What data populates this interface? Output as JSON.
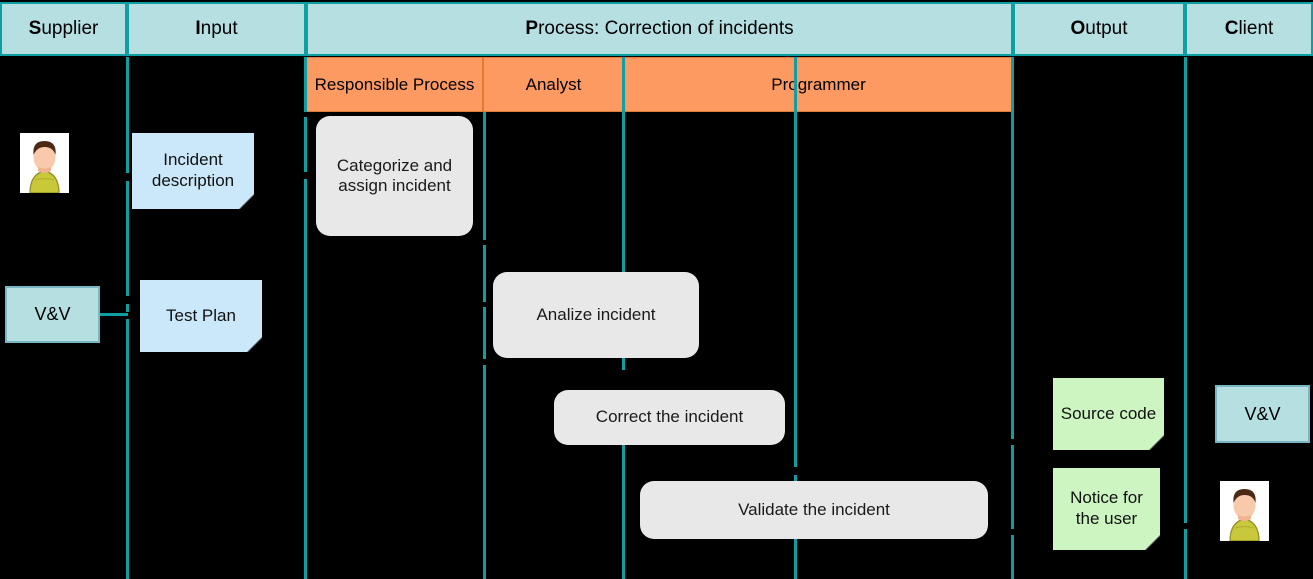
{
  "diagram": {
    "type": "SIPOC swimlane process diagram",
    "columns": [
      {
        "key": "supplier",
        "cap": "S",
        "rest": "upplier"
      },
      {
        "key": "input",
        "cap": "I",
        "rest": "nput"
      },
      {
        "key": "process",
        "cap": "P",
        "rest": "rocess: Correction of incidents"
      },
      {
        "key": "output",
        "cap": "O",
        "rest": "utput"
      },
      {
        "key": "client",
        "cap": "C",
        "rest": "lient"
      }
    ],
    "lanes": [
      {
        "key": "responsible",
        "label": "Responsible Process"
      },
      {
        "key": "analyst",
        "label": "Analyst"
      },
      {
        "key": "programmer",
        "label": "Programmer"
      }
    ],
    "supplier": {
      "avatar_label": "user-avatar",
      "vv_label": "V&V"
    },
    "input": {
      "doc_1": "Incident description",
      "doc_2": "Test Plan"
    },
    "process": {
      "step_1": "Categorize and assign incident",
      "step_2": "Analize incident",
      "step_3": "Correct the incident",
      "step_4": "Validate the incident"
    },
    "output": {
      "doc_1": "Source code",
      "doc_2": "Notice for the user"
    },
    "client": {
      "vv_label": "V&V",
      "avatar_label": "user-avatar"
    },
    "colors": {
      "header_fill": "#b6dfe2",
      "header_border": "#0f9ea2",
      "lane_fill": "#fd9a62",
      "lane_border": "#e07a36",
      "process_fill": "#e8e8e8",
      "input_doc_fill": "#cbe8fb",
      "output_doc_fill": "#ccf5c2",
      "background": "#000000"
    }
  }
}
